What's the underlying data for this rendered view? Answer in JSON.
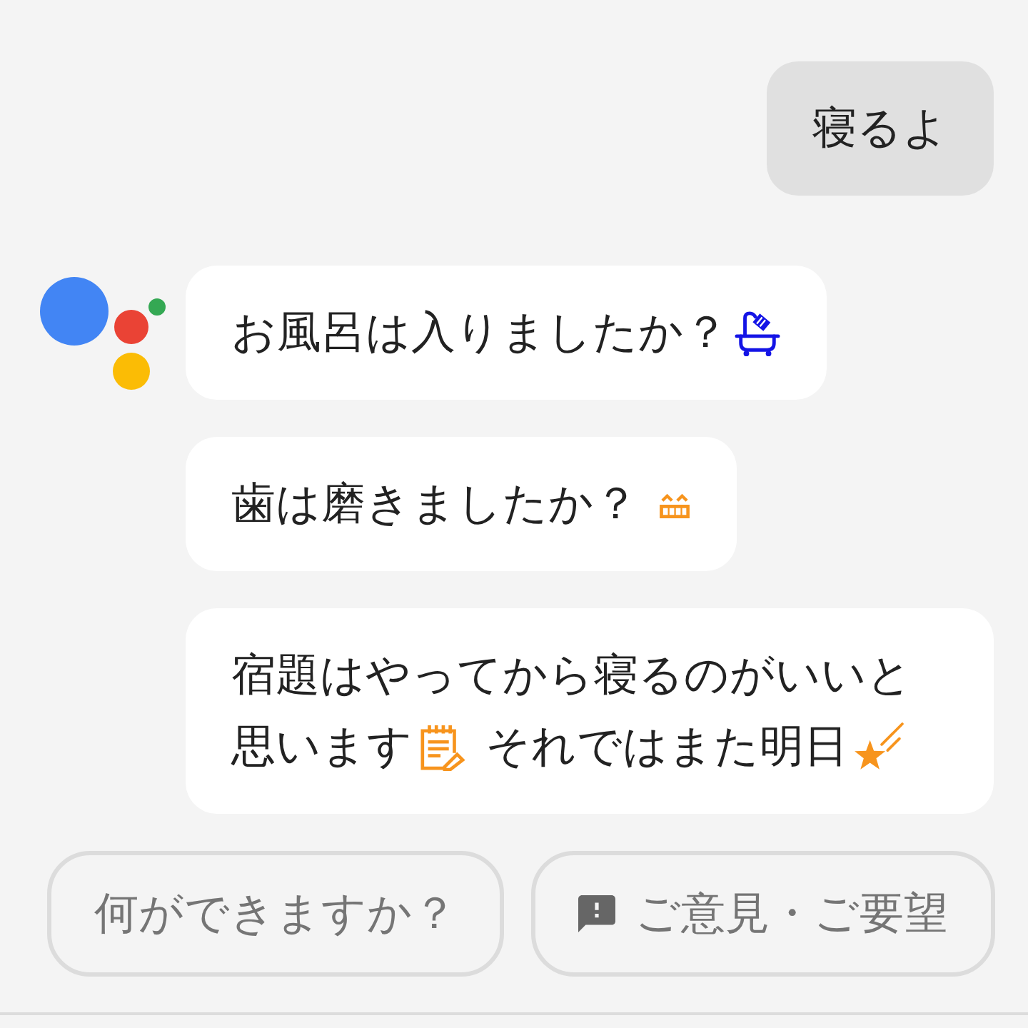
{
  "messages": [
    {
      "kind": "user",
      "lines": [
        [
          {
            "kind": "text",
            "text": "寝るよ"
          }
        ]
      ]
    },
    {
      "kind": "assistant",
      "lines": [
        [
          {
            "kind": "text",
            "text": "お風呂は入りましたか？"
          },
          {
            "kind": "bath"
          }
        ]
      ]
    },
    {
      "kind": "assistant",
      "lines": [
        [
          {
            "kind": "text",
            "text": "歯は磨きましたか？"
          },
          {
            "kind": "grin"
          }
        ]
      ]
    },
    {
      "kind": "assistant",
      "lines": [
        [
          {
            "kind": "text",
            "text": "宿題はやってから寝るのがいいと"
          }
        ],
        [
          {
            "kind": "text",
            "text": "思います"
          },
          {
            "kind": "memo"
          },
          {
            "kind": "text",
            "text": "それではまた明日"
          },
          {
            "kind": "star"
          }
        ]
      ]
    }
  ],
  "suggestions": [
    {
      "kind": "plain",
      "label": "何ができますか？"
    },
    {
      "kind": "feedback",
      "label": "ご意見・ご要望"
    }
  ]
}
